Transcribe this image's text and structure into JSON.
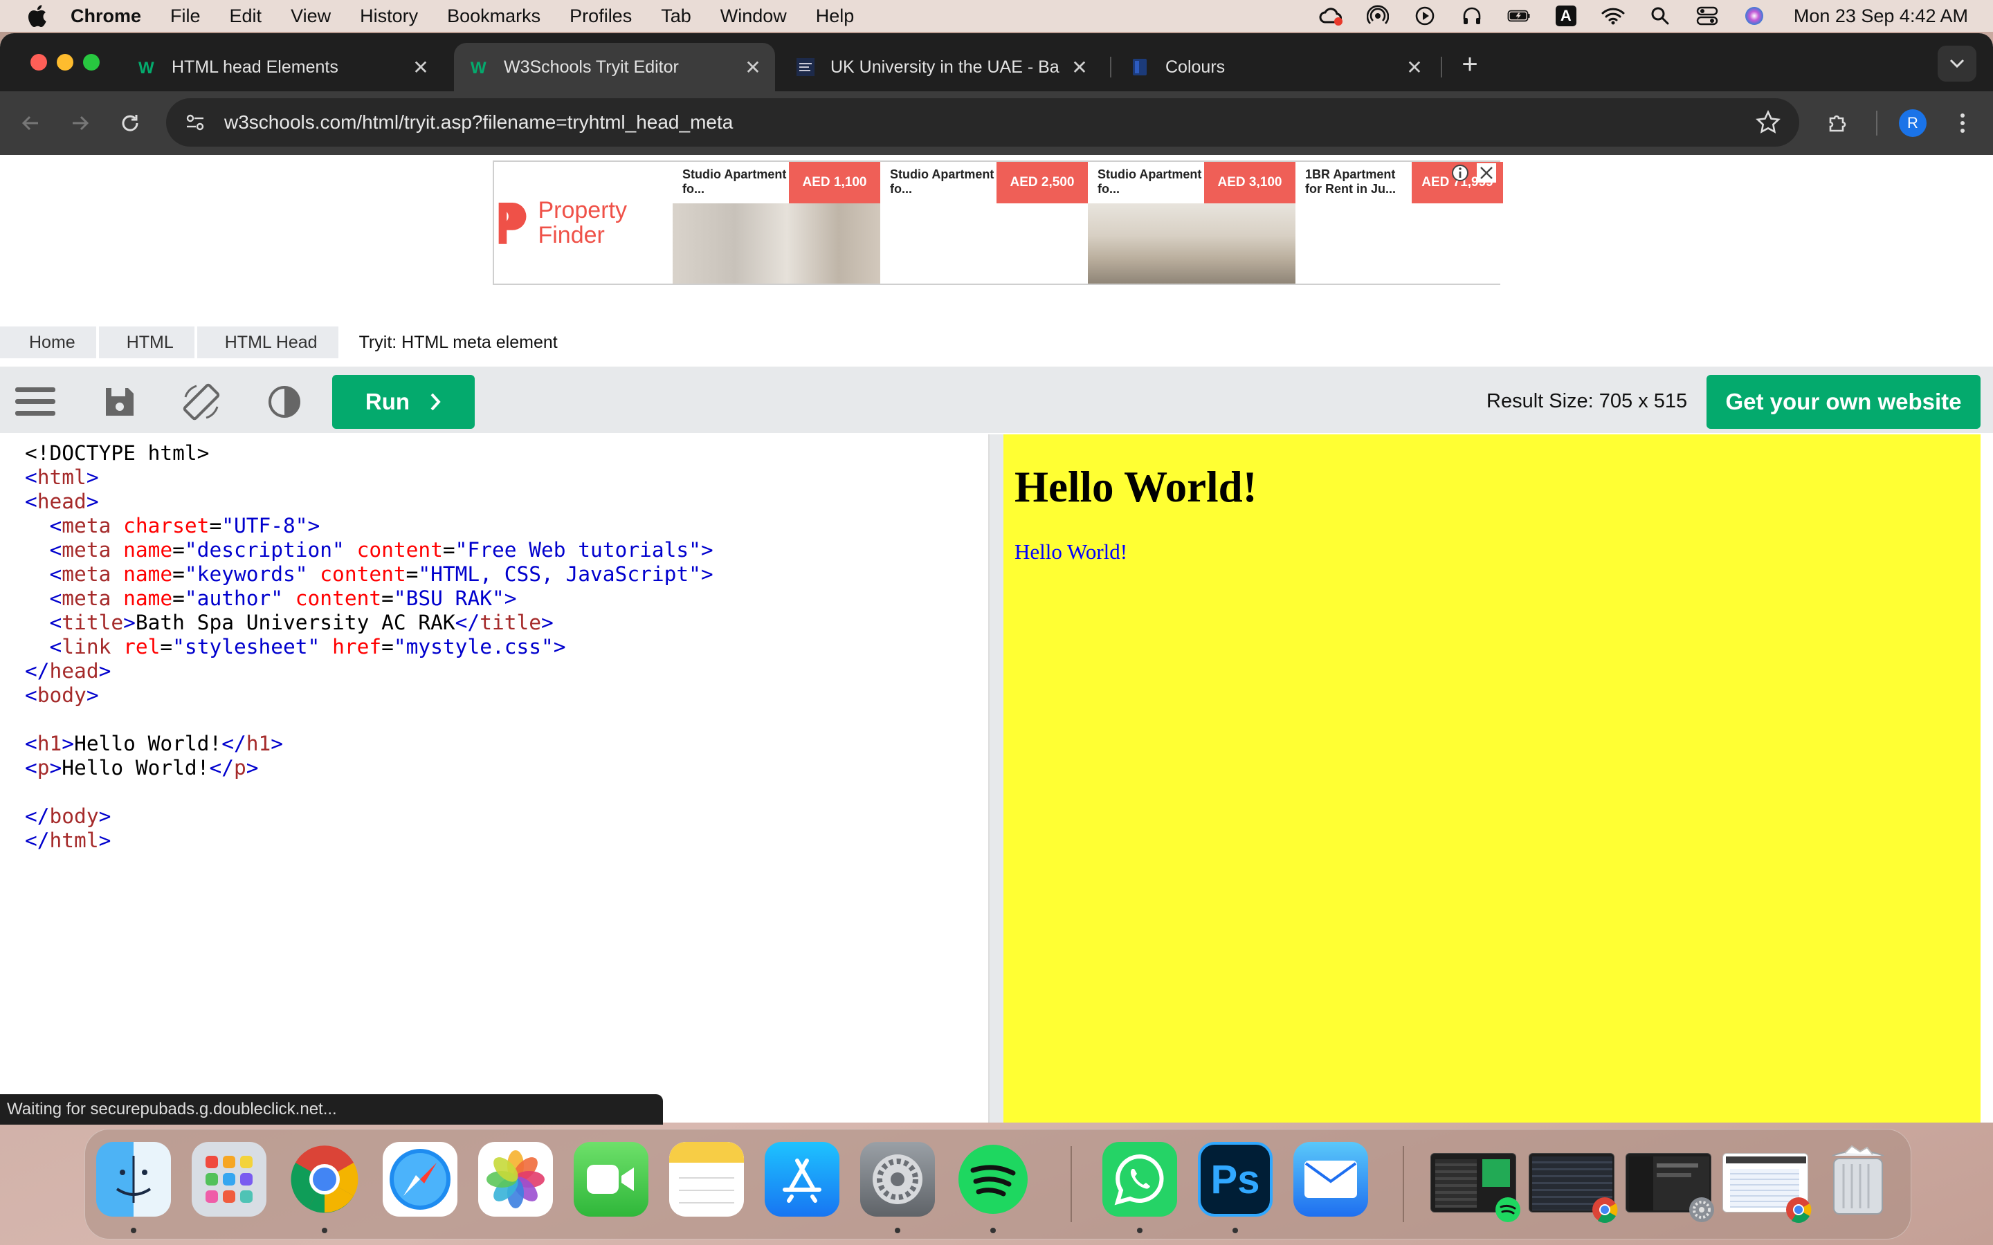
{
  "menubar": {
    "app_name": "Chrome",
    "items": [
      "File",
      "Edit",
      "View",
      "History",
      "Bookmarks",
      "Profiles",
      "Tab",
      "Window",
      "Help"
    ],
    "clock": "Mon 23 Sep  4:42 AM",
    "input_source": "A"
  },
  "browser": {
    "tabs": [
      {
        "title": "HTML head Elements",
        "active": false
      },
      {
        "title": "W3Schools Tryit Editor",
        "active": true
      },
      {
        "title": "UK University in the UAE - Ba",
        "active": false
      },
      {
        "title": "Colours",
        "active": false
      }
    ],
    "url": "w3schools.com/html/tryit.asp?filename=tryhtml_head_meta",
    "profile_initial": "R",
    "status_text": "Waiting for securepubads.g.doubleclick.net..."
  },
  "ad": {
    "brand": "Property Finder",
    "brand_color": "#ef5148",
    "cards": [
      {
        "label": "Studio Apartment fo...",
        "price": "AED 1,100"
      },
      {
        "label": "Studio Apartment fo...",
        "price": "AED 2,500"
      },
      {
        "label": "Studio Apartment fo...",
        "price": "AED 3,100"
      },
      {
        "label": "1BR Apartment for Rent in Ju...",
        "price": "AED 71,999"
      }
    ]
  },
  "breadcrumbs": [
    "Home",
    "HTML",
    "HTML Head",
    "Tryit: HTML meta element"
  ],
  "editor": {
    "run_label": "Run",
    "result_size": "Result Size: 705 x 515",
    "get_site_label": "Get your own website",
    "accent": "#04aa6d",
    "code_lines": [
      [
        [
          "tx",
          "<!DOCTYPE html>"
        ]
      ],
      [
        [
          "br",
          "<"
        ],
        [
          "tg",
          "html"
        ],
        [
          "br",
          ">"
        ]
      ],
      [
        [
          "br",
          "<"
        ],
        [
          "tg",
          "head"
        ],
        [
          "br",
          ">"
        ]
      ],
      [
        [
          "tx",
          "  "
        ],
        [
          "br",
          "<"
        ],
        [
          "tg",
          "meta "
        ],
        [
          "at",
          "charset"
        ],
        [
          "tx",
          "="
        ],
        [
          "vl",
          "\"UTF-8\""
        ],
        [
          "br",
          ">"
        ]
      ],
      [
        [
          "tx",
          "  "
        ],
        [
          "br",
          "<"
        ],
        [
          "tg",
          "meta "
        ],
        [
          "at",
          "name"
        ],
        [
          "tx",
          "="
        ],
        [
          "vl",
          "\"description\" "
        ],
        [
          "at",
          "content"
        ],
        [
          "tx",
          "="
        ],
        [
          "vl",
          "\"Free Web tutorials\""
        ],
        [
          "br",
          ">"
        ]
      ],
      [
        [
          "tx",
          "  "
        ],
        [
          "br",
          "<"
        ],
        [
          "tg",
          "meta "
        ],
        [
          "at",
          "name"
        ],
        [
          "tx",
          "="
        ],
        [
          "vl",
          "\"keywords\" "
        ],
        [
          "at",
          "content"
        ],
        [
          "tx",
          "="
        ],
        [
          "vl",
          "\"HTML, CSS, JavaScript\""
        ],
        [
          "br",
          ">"
        ]
      ],
      [
        [
          "tx",
          "  "
        ],
        [
          "br",
          "<"
        ],
        [
          "tg",
          "meta "
        ],
        [
          "at",
          "name"
        ],
        [
          "tx",
          "="
        ],
        [
          "vl",
          "\"author\" "
        ],
        [
          "at",
          "content"
        ],
        [
          "tx",
          "="
        ],
        [
          "vl",
          "\"BSU RAK\""
        ],
        [
          "br",
          ">"
        ]
      ],
      [
        [
          "tx",
          "  "
        ],
        [
          "br",
          "<"
        ],
        [
          "tg",
          "title"
        ],
        [
          "br",
          ">"
        ],
        [
          "tx",
          "Bath Spa University AC RAK"
        ],
        [
          "br",
          "</"
        ],
        [
          "tg",
          "title"
        ],
        [
          "br",
          ">"
        ]
      ],
      [
        [
          "tx",
          "  "
        ],
        [
          "br",
          "<"
        ],
        [
          "tg",
          "link "
        ],
        [
          "at",
          "rel"
        ],
        [
          "tx",
          "="
        ],
        [
          "vl",
          "\"stylesheet\" "
        ],
        [
          "at",
          "href"
        ],
        [
          "tx",
          "="
        ],
        [
          "vl",
          "\"mystyle.css\""
        ],
        [
          "br",
          ">"
        ]
      ],
      [
        [
          "br",
          "</"
        ],
        [
          "tg",
          "head"
        ],
        [
          "br",
          ">"
        ]
      ],
      [
        [
          "br",
          "<"
        ],
        [
          "tg",
          "body"
        ],
        [
          "br",
          ">"
        ]
      ],
      [],
      [
        [
          "br",
          "<"
        ],
        [
          "tg",
          "h1"
        ],
        [
          "br",
          ">"
        ],
        [
          "tx",
          "Hello World!"
        ],
        [
          "br",
          "</"
        ],
        [
          "tg",
          "h1"
        ],
        [
          "br",
          ">"
        ]
      ],
      [
        [
          "br",
          "<"
        ],
        [
          "tg",
          "p"
        ],
        [
          "br",
          ">"
        ],
        [
          "tx",
          "Hello World!"
        ],
        [
          "br",
          "</"
        ],
        [
          "tg",
          "p"
        ],
        [
          "br",
          ">"
        ]
      ],
      [],
      [
        [
          "br",
          "</"
        ],
        [
          "tg",
          "body"
        ],
        [
          "br",
          ">"
        ]
      ],
      [
        [
          "br",
          "</"
        ],
        [
          "tg",
          "html"
        ],
        [
          "br",
          ">"
        ]
      ]
    ]
  },
  "result": {
    "heading": "Hello World!",
    "paragraph": "Hello World!",
    "background": "#ffff33"
  },
  "dock": {
    "apps": [
      "finder-icon",
      "launchpad-icon",
      "chrome-icon",
      "safari-icon",
      "photos-icon",
      "facetime-icon",
      "notes-icon",
      "app-store-icon",
      "system-settings-icon",
      "spotify-icon",
      "whatsapp-icon",
      "photoshop-icon",
      "mail-icon"
    ],
    "photoshop_label": "Ps"
  }
}
